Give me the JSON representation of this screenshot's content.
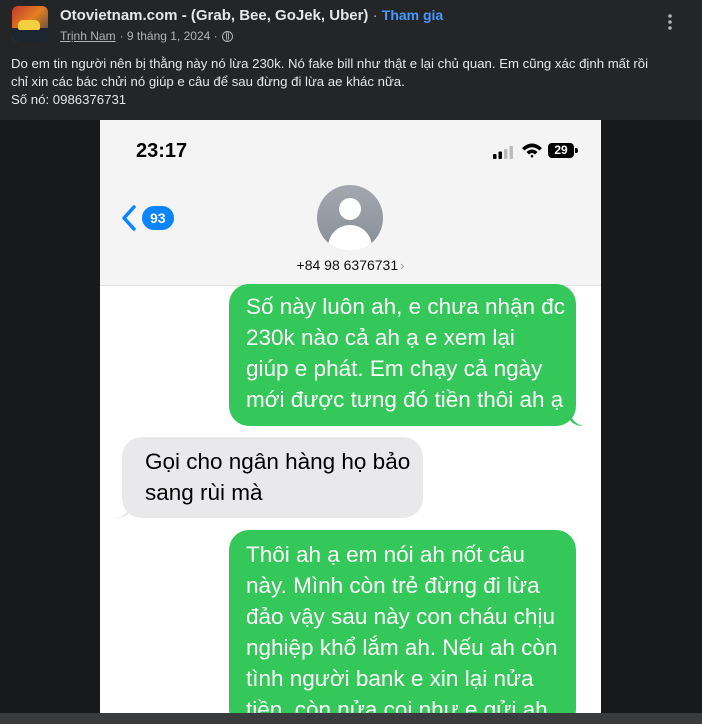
{
  "post": {
    "group_name": "Otovietnam.com - (Grab, Bee, GoJek, Uber)",
    "join_separator": "·",
    "join_label": "Tham gia",
    "author": "Trịnh Nam",
    "date": "· 9 tháng 1, 2024 ·",
    "body_lines": [
      "Do em tin người nên bị thằng này nó lừa 230k. Nó fake bill như thật e lại chủ quan. Em cũng xác định mất rồi",
      "chỉ xin các bác chửi nó giúp e câu để sau đừng đi lừa ae khác nữa.",
      "Số nó: 0986376731"
    ]
  },
  "phone": {
    "time": "23:17",
    "battery": "29",
    "back_count": "93",
    "contact": "+84 98 6376731",
    "messages": [
      {
        "direction": "out",
        "lines": [
          "Số này luôn ah, e chưa nhận đc",
          "230k nào cả ah ạ e xem lại",
          "giúp e phát. Em chạy cả ngày",
          "mới được tưng đó tiền thôi ah ạ"
        ]
      },
      {
        "direction": "in",
        "lines": [
          "Gọi cho ngân hàng họ bảo",
          "sang rùi mà"
        ]
      },
      {
        "direction": "out",
        "lines": [
          "Thôi ah ạ em nói ah nốt câu",
          "này. Mình còn trẻ đừng đi lừa",
          "đảo vậy sau này con cháu chịu",
          "nghiệp khổ lắm ah. Nếu ah còn",
          "tình người bank e xin lại nửa",
          "tiền. còn nửa coi như e gửi ah"
        ]
      }
    ]
  },
  "icons": {
    "more": "more-options-icon",
    "privacy": "globe-icon",
    "back": "chevron-left-icon"
  },
  "colors": {
    "facebook_link": "#4599ff",
    "imessage_green": "#34c759",
    "incoming_gray": "#e9e9eb",
    "ios_blue": "#0a84ff"
  }
}
